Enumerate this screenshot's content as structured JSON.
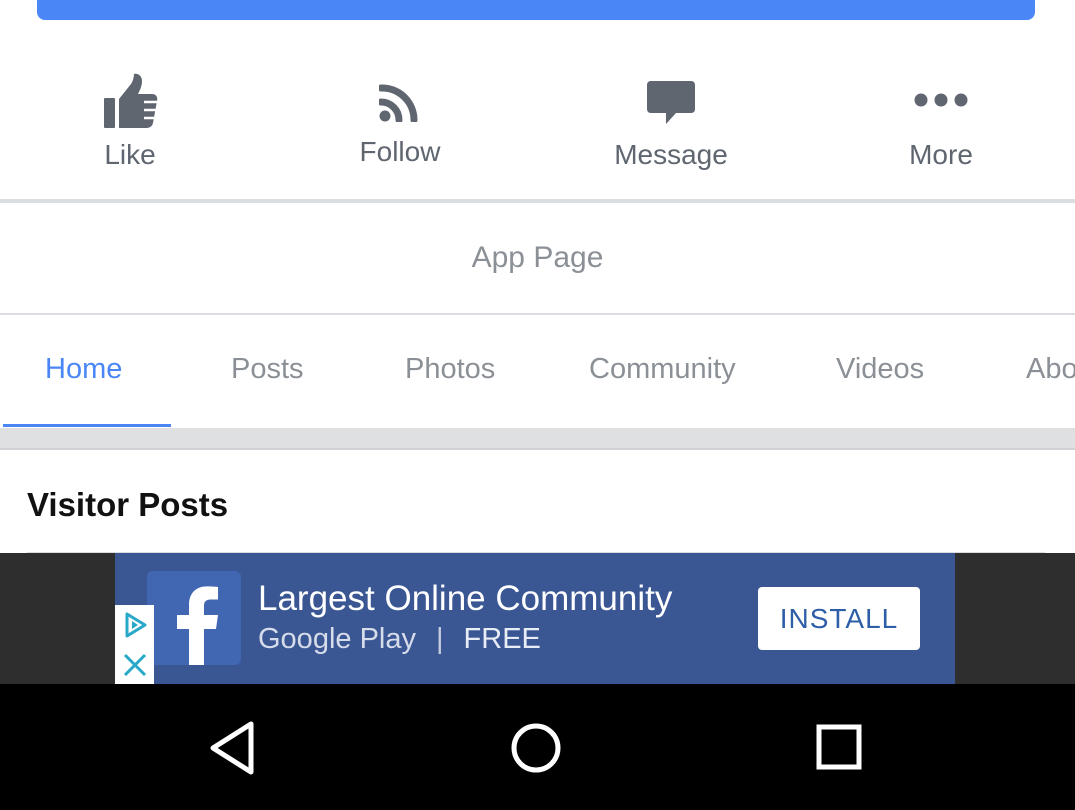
{
  "actions": {
    "like": "Like",
    "follow": "Follow",
    "message": "Message",
    "more": "More"
  },
  "page_category": "App Page",
  "tabs": [
    {
      "label": "Home",
      "active": true
    },
    {
      "label": "Posts"
    },
    {
      "label": "Photos"
    },
    {
      "label": "Community"
    },
    {
      "label": "Videos"
    },
    {
      "label": "About"
    }
  ],
  "section_title": "Visitor Posts",
  "ad": {
    "title": "Largest Online Community",
    "store": "Google Play",
    "separator": "|",
    "price": "FREE",
    "button": "INSTALL"
  },
  "colors": {
    "accent": "#4a86f5",
    "ad_background": "#3a5794",
    "icon_gray": "#5f6670",
    "muted_text": "#8b9096"
  },
  "icons": {
    "like": "thumbs-up-icon",
    "follow": "rss-icon",
    "message": "speech-bubble-icon",
    "more": "ellipsis-icon",
    "ad_logo": "facebook-f-icon",
    "ad_choices": "adchoices-icon",
    "ad_close": "close-icon",
    "nav_back": "back-triangle-icon",
    "nav_home": "home-circle-icon",
    "nav_recent": "recents-square-icon"
  }
}
